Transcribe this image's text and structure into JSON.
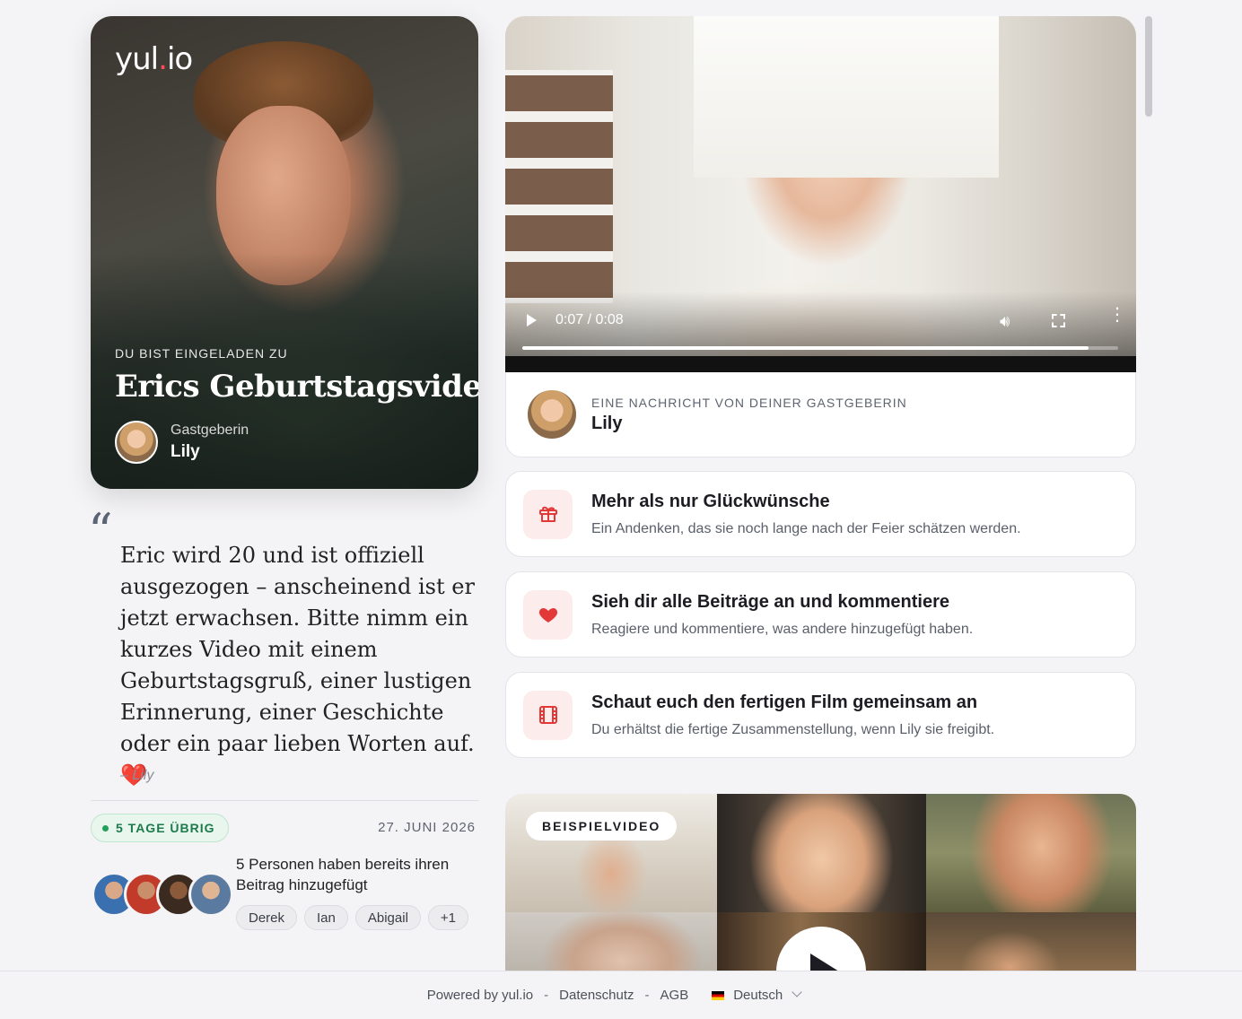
{
  "hero": {
    "logo_main": "yul",
    "logo_dot": ".",
    "logo_tld": "io",
    "kicker": "DU BIST EINGELADEN ZU",
    "title": "Erics Geburtstagsvideo",
    "host_role": "Gastgeberin",
    "host_name": "Lily"
  },
  "quote": {
    "text": "Eric wird 20 und ist offiziell ausgezogen – anscheinend ist er jetzt erwachsen. Bitte nimm ein kurzes Video mit einem Geburtstagsgruß, einer lustigen Erinnerung, einer Geschichte oder ein paar lieben Worten auf.",
    "emoji": "❤️",
    "author": "– Lily"
  },
  "status": {
    "days_left": "5 TAGE ÜBRIG",
    "deadline": "27. JUNI 2026",
    "contributors_text": "5 Personen haben bereits ihren Beitrag hinzugefügt",
    "chips": [
      "Derek",
      "Ian",
      "Abigail",
      "+1"
    ]
  },
  "video": {
    "time": "0:07 / 0:08",
    "progress": 0.95
  },
  "message": {
    "kicker": "EINE NACHRICHT VON DEINER GASTGEBERIN",
    "name": "Lily"
  },
  "features": [
    {
      "icon": "gift-icon",
      "title": "Mehr als nur Glückwünsche",
      "subtitle": "Ein Andenken, das sie noch lange nach der Feier schätzen werden."
    },
    {
      "icon": "heart-icon",
      "title": "Sieh dir alle Beiträge an und kommentiere",
      "subtitle": "Reagiere und kommentiere, was andere hinzugefügt haben."
    },
    {
      "icon": "film-icon",
      "title": "Schaut euch den fertigen Film gemeinsam an",
      "subtitle": "Du erhältst die fertige Zusammenstellung, wenn Lily sie freigibt."
    }
  ],
  "sample": {
    "badge": "BEISPIELVIDEO"
  },
  "footer": {
    "powered": "Powered by yul.io",
    "sep": "-",
    "privacy": "Datenschutz",
    "terms": "AGB",
    "language": "Deutsch"
  },
  "colors": {
    "accent": "#e23838",
    "success": "#1d7a4a"
  }
}
